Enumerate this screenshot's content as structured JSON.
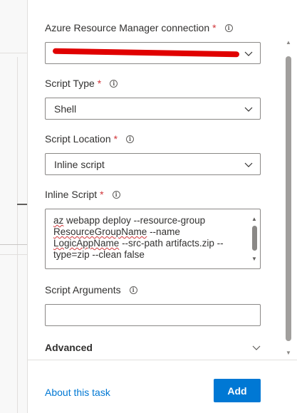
{
  "fields": {
    "arm_connection": {
      "label": "Azure Resource Manager connection",
      "required_mark": "*",
      "value": ""
    },
    "script_type": {
      "label": "Script Type",
      "required_mark": "*",
      "value": "Shell"
    },
    "script_location": {
      "label": "Script Location",
      "required_mark": "*",
      "value": "Inline script"
    },
    "inline_script": {
      "label": "Inline Script",
      "required_mark": "*",
      "lines": [
        [
          "az",
          " webapp deploy --resource-group"
        ],
        [
          "ResourceGroupName",
          " --name"
        ],
        [
          "LogicAppName",
          " --src-path artifacts.zip --"
        ],
        [
          "",
          "type=zip --clean false"
        ]
      ]
    },
    "script_arguments": {
      "label": "Script Arguments",
      "value": ""
    }
  },
  "advanced": {
    "label": "Advanced"
  },
  "footer": {
    "about_link": "About this task",
    "add_label": "Add"
  },
  "icons": {
    "info": "info-icon",
    "chevron": "chevron-down-icon"
  },
  "colors": {
    "accent": "#0078d4",
    "required": "#d13438",
    "redaction": "#e00000"
  }
}
